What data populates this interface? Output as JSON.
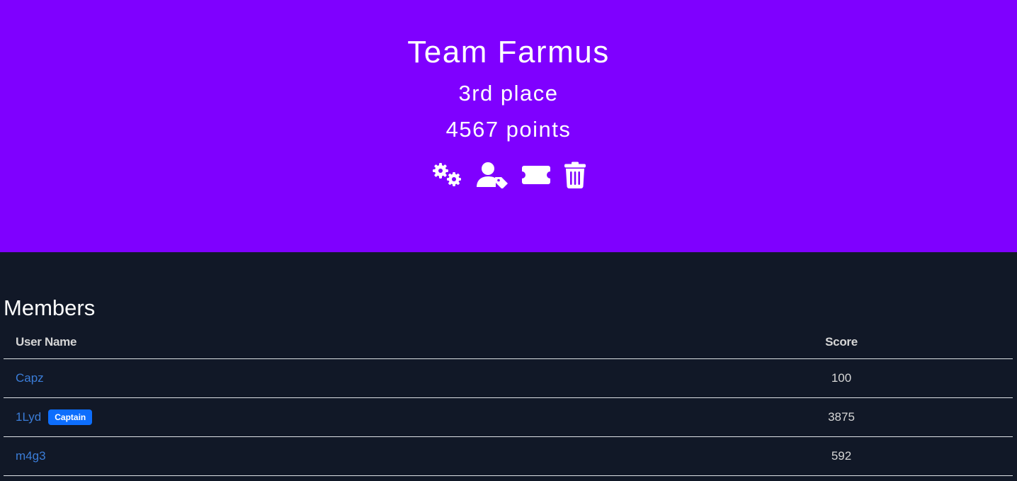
{
  "hero": {
    "team_name": "Team Farmus",
    "place": "3rd place",
    "points": "4567 points",
    "background_color": "#7f00ff",
    "actions": [
      {
        "icon": "gears-icon",
        "label": "settings"
      },
      {
        "icon": "user-tag-icon",
        "label": "captain"
      },
      {
        "icon": "ticket-icon",
        "label": "invite"
      },
      {
        "icon": "trash-icon",
        "label": "delete"
      }
    ]
  },
  "members": {
    "title": "Members",
    "columns": {
      "user_name": "User Name",
      "score": "Score"
    },
    "rows": [
      {
        "name": "Capz",
        "score": "100",
        "badge": ""
      },
      {
        "name": "1Lyd",
        "score": "3875",
        "badge": "Captain"
      },
      {
        "name": "m4g3",
        "score": "592",
        "badge": ""
      }
    ]
  },
  "colors": {
    "page_background": "#111827",
    "link": "#3b7dd8",
    "badge": "#0d6efd"
  }
}
